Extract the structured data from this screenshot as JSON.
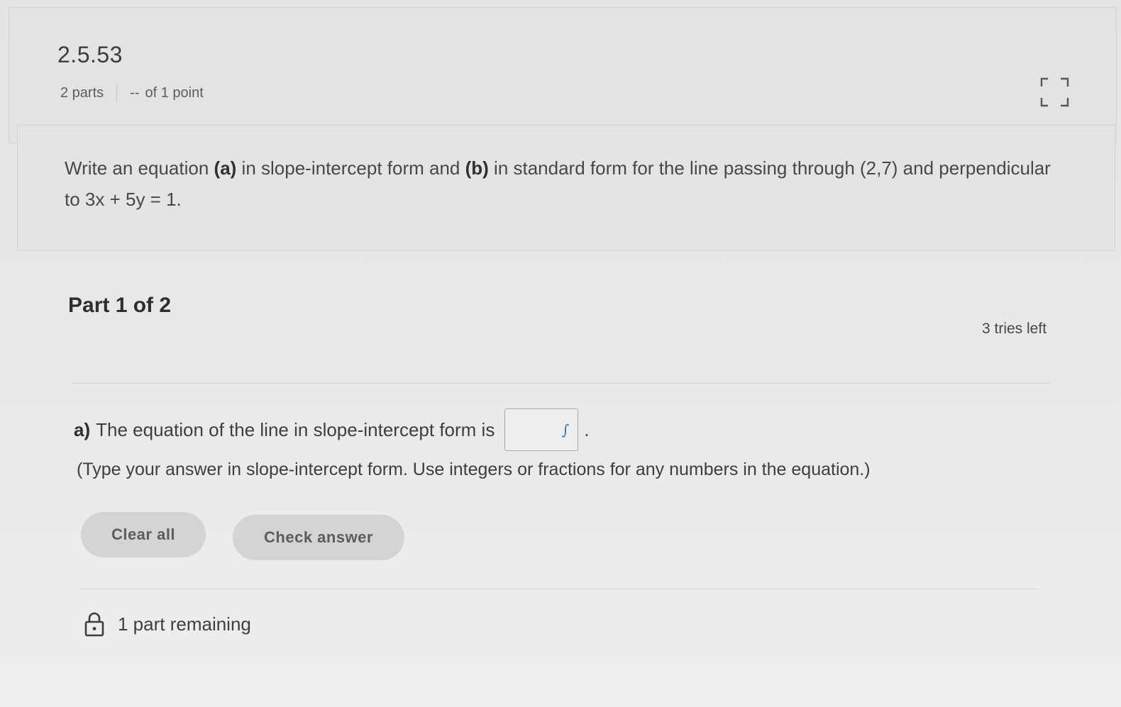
{
  "header": {
    "problem_id": "2.5.53",
    "parts": "2 parts",
    "points_score": "--",
    "points_total": "of 1 point",
    "expand_icon": "expand-icon"
  },
  "question": {
    "intro": "Write an equation ",
    "part_a_label": "(a)",
    "mid1": " in slope-intercept form and ",
    "part_b_label": "(b)",
    "mid2": " in standard form for the line passing through (2,7) and perpendicular to 3x + 5y = 1."
  },
  "part": {
    "title": "Part 1 of 2",
    "tries_left": "3 tries left"
  },
  "answer": {
    "label": "a)",
    "prompt": "The equation of the line in slope-intercept form is",
    "input_value": "",
    "math_icon": "∫",
    "suffix": ".",
    "hint": "(Type your answer in slope-intercept form. Use integers or fractions for any numbers in the equation.)"
  },
  "buttons": {
    "clear_all": "Clear all",
    "check_answer": "Check answer"
  },
  "footer": {
    "remaining": "1 part remaining",
    "icon": "lock-icon"
  }
}
